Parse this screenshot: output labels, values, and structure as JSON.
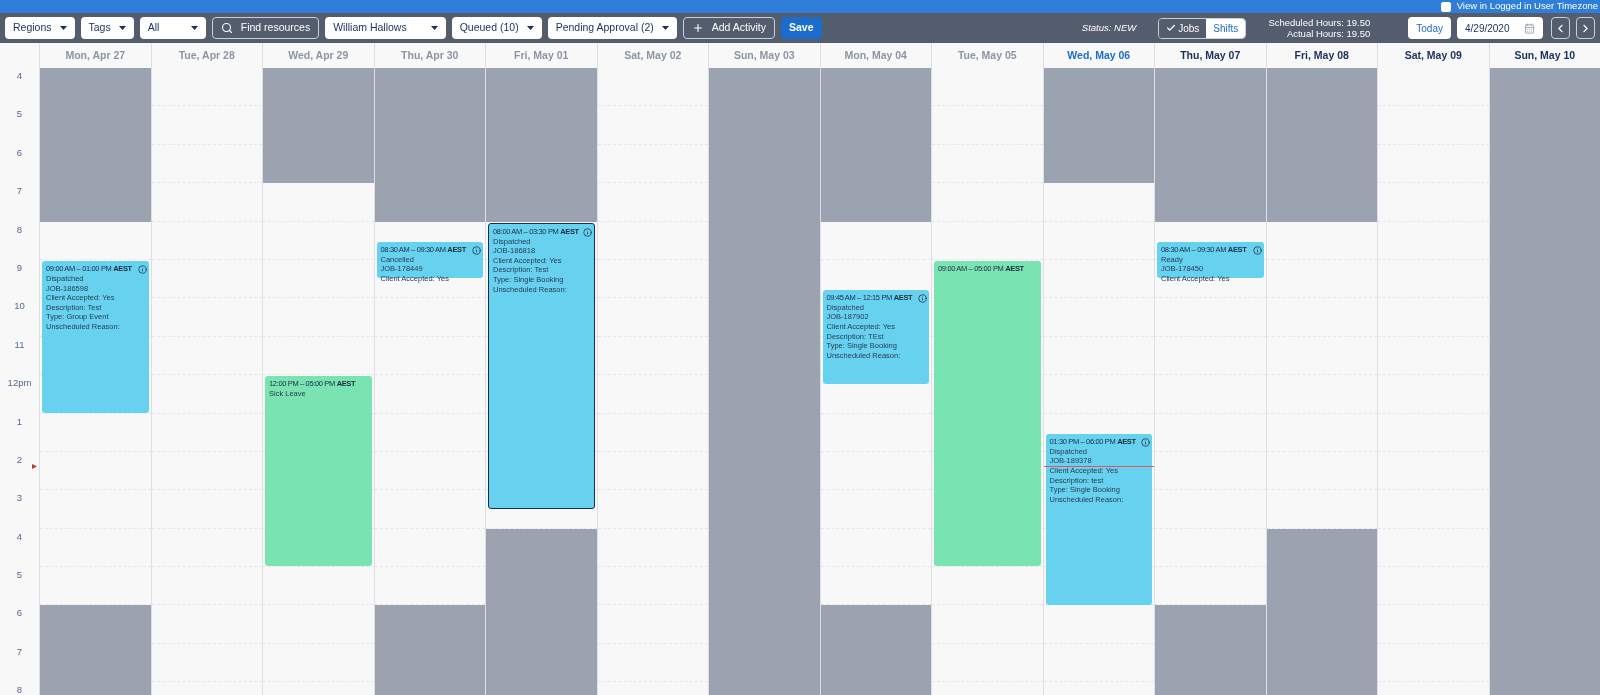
{
  "top_bar": {
    "timezone_checkbox": {
      "label": "View in Logged in User Timezone",
      "checked": false
    }
  },
  "toolbar": {
    "items": [
      {
        "kind": "dropdown",
        "label": "Regions"
      },
      {
        "kind": "dropdown",
        "label": "Tags"
      },
      {
        "kind": "select",
        "label": "All"
      },
      {
        "kind": "search",
        "label": "Find resources"
      },
      {
        "kind": "select",
        "label": "William Hallows"
      },
      {
        "kind": "dropdown",
        "label": "Queued (10)"
      },
      {
        "kind": "dropdown",
        "label": "Pending Approval (2)"
      },
      {
        "kind": "add",
        "label": "Add Activity"
      },
      {
        "kind": "primary",
        "label": "Save"
      }
    ],
    "status": {
      "label": "Status:",
      "value": "NEW"
    },
    "view_toggle": [
      {
        "label": "Jobs",
        "selected": true
      },
      {
        "label": "Shifts",
        "selected": false
      }
    ],
    "hours": [
      "Scheduled Hours: 19.50",
      "Actual Hours: 19.50"
    ],
    "today_button": "Today",
    "date_field": {
      "value": "4/29/2020"
    }
  },
  "calendar": {
    "hour_labels": [
      "4",
      "5",
      "6",
      "7",
      "8",
      "9",
      "10",
      "11",
      "12pm",
      "1",
      "2",
      "3",
      "4",
      "5",
      "6",
      "7",
      "8"
    ],
    "days": [
      {
        "label": "Mon, Apr 27",
        "kind": "past",
        "unavailable_hours": [
          true,
          true,
          true,
          true,
          false,
          false,
          false,
          false,
          false,
          false,
          false,
          false,
          false,
          false,
          true,
          true,
          true
        ],
        "events": [
          {
            "kind": "job",
            "selected": false,
            "time": "09:00 AM – 01:00 PM",
            "zone": "AEST",
            "lines": [
              "Dispatched",
              "JOB-186598",
              "Client Accepted: Yes",
              "Description: Test",
              "Type: Group Event",
              "Unscheduled Reason:"
            ]
          }
        ]
      },
      {
        "label": "Tue, Apr 28",
        "kind": "past",
        "unavailable_hours": [
          false,
          false,
          false,
          false,
          false,
          false,
          false,
          false,
          false,
          false,
          false,
          false,
          false,
          false,
          false,
          false,
          false
        ]
      },
      {
        "label": "Wed, Apr 29",
        "kind": "past",
        "unavailable_hours": [
          true,
          true,
          true,
          false,
          false,
          false,
          false,
          false,
          false,
          false,
          false,
          false,
          false,
          false,
          false,
          false,
          false
        ],
        "events": [
          {
            "kind": "leave",
            "selected": false,
            "time": "12:00 PM – 05:00 PM",
            "zone": "AEST",
            "lines": [
              "Sick Leave"
            ]
          }
        ]
      },
      {
        "label": "Thu, Apr 30",
        "kind": "past",
        "unavailable_hours": [
          true,
          true,
          true,
          true,
          false,
          false,
          false,
          false,
          false,
          false,
          false,
          false,
          false,
          false,
          true,
          true,
          true
        ],
        "events": [
          {
            "kind": "job",
            "selected": false,
            "time": "08:30 AM – 09:30 AM",
            "zone": "AEST",
            "lines": [
              "Cancelled",
              "JOB-178449",
              "Client Accepted: Yes"
            ]
          }
        ]
      },
      {
        "label": "Fri, May 01",
        "kind": "past",
        "unavailable_hours": [
          true,
          true,
          true,
          true,
          false,
          false,
          false,
          false,
          false,
          false,
          false,
          false,
          true,
          true,
          true,
          true,
          true
        ],
        "events": [
          {
            "kind": "job",
            "selected": true,
            "time": "08:00 AM – 03:30 PM",
            "zone": "AEST",
            "lines": [
              "Dispatched",
              "JOB-186818",
              "Client Accepted: Yes",
              "Description: Test",
              "Type: Single Booking",
              "Unscheduled Reason:"
            ]
          }
        ]
      },
      {
        "label": "Sat, May 02",
        "kind": "past",
        "unavailable_hours": [
          false,
          false,
          false,
          false,
          false,
          false,
          false,
          false,
          false,
          false,
          false,
          false,
          false,
          false,
          false,
          false,
          false
        ]
      },
      {
        "label": "Sun, May 03",
        "kind": "past",
        "unavailable_hours": [
          true,
          true,
          true,
          true,
          true,
          true,
          true,
          true,
          true,
          true,
          true,
          true,
          true,
          true,
          true,
          true,
          true
        ]
      },
      {
        "label": "Mon, May 04",
        "kind": "past",
        "unavailable_hours": [
          true,
          true,
          true,
          true,
          false,
          false,
          false,
          false,
          false,
          false,
          false,
          false,
          false,
          false,
          true,
          true,
          true
        ],
        "events": [
          {
            "kind": "job",
            "selected": false,
            "time": "09:45 AM – 12:15 PM",
            "zone": "AEST",
            "lines": [
              "Dispatched",
              "JOB-187902",
              "Client Accepted: Yes",
              "Description: TEst",
              "Type: Single Booking",
              "Unscheduled Reason:"
            ]
          }
        ]
      },
      {
        "label": "Tue, May 05",
        "kind": "past",
        "unavailable_hours": [
          false,
          false,
          false,
          false,
          false,
          false,
          false,
          false,
          false,
          false,
          false,
          false,
          false,
          false,
          false,
          false,
          false
        ],
        "events": [
          {
            "kind": "leave",
            "selected": false,
            "time": "09:00 AM – 05:00 PM",
            "zone": "AEST"
          }
        ]
      },
      {
        "label": "Wed, May 06",
        "kind": "today",
        "unavailable_hours": [
          true,
          true,
          true,
          false,
          false,
          false,
          false,
          false,
          false,
          false,
          false,
          false,
          false,
          false,
          false,
          false,
          false
        ],
        "events": [
          {
            "kind": "job",
            "selected": false,
            "time": "01:30 PM – 06:00 PM",
            "zone": "AEST",
            "lines": [
              "Dispatched",
              "JOB-189378",
              "Client Accepted: Yes",
              "Description: test",
              "Type: Single Booking",
              "Unscheduled Reason:"
            ]
          }
        ]
      },
      {
        "label": "Thu, May 07",
        "kind": "future",
        "unavailable_hours": [
          true,
          true,
          true,
          true,
          false,
          false,
          false,
          false,
          false,
          false,
          false,
          false,
          false,
          false,
          true,
          true,
          true
        ],
        "events": [
          {
            "kind": "job",
            "selected": false,
            "time": "08:30 AM – 09:30 AM",
            "zone": "AEST",
            "lines": [
              "Ready",
              "JOB-178450",
              "Client Accepted: Yes"
            ]
          }
        ]
      },
      {
        "label": "Fri, May 08",
        "kind": "future",
        "unavailable_hours": [
          true,
          true,
          true,
          true,
          false,
          false,
          false,
          false,
          false,
          false,
          false,
          false,
          true,
          true,
          true,
          true,
          true
        ]
      },
      {
        "label": "Sat, May 09",
        "kind": "future",
        "unavailable_hours": [
          false,
          false,
          false,
          false,
          false,
          false,
          false,
          false,
          false,
          false,
          false,
          false,
          false,
          false,
          false,
          false,
          false
        ]
      },
      {
        "label": "Sun, May 10",
        "kind": "future",
        "unavailable_hours": [
          true,
          true,
          true,
          true,
          true,
          true,
          true,
          true,
          true,
          true,
          true,
          true,
          true,
          true,
          true,
          true,
          true
        ]
      }
    ]
  }
}
